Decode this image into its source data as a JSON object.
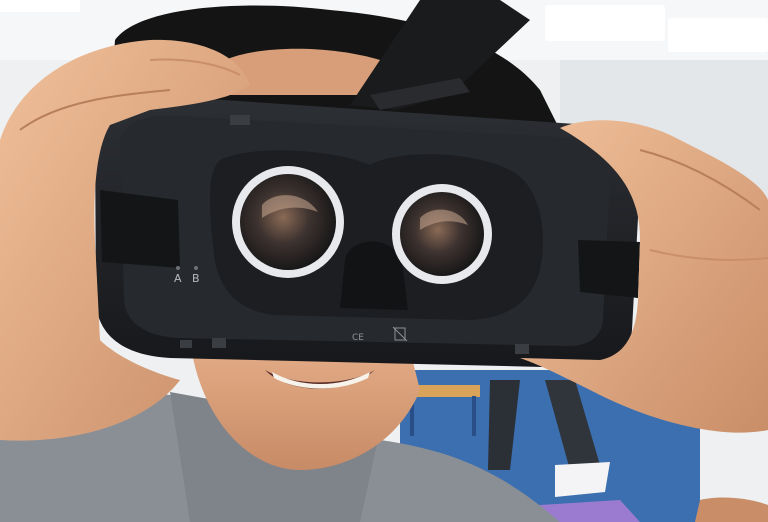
{
  "photo": {
    "subject": "person-wearing-vr-headset",
    "headset": {
      "switch_labels": [
        "A",
        "B"
      ],
      "certification_marks": [
        "CE"
      ],
      "lens_count": 2
    },
    "colors": {
      "ceiling": "#f1f3f5",
      "wall_blue": "#2f5f9a",
      "floor": "#3b6fb0",
      "headset_body": "#1f2124",
      "headset_inner": "#2b2e33",
      "lens_ring": "#e7e9ec",
      "skin": "#e2ad86",
      "sweater": "#8a8f96",
      "strap": "#1a1b1d"
    }
  }
}
